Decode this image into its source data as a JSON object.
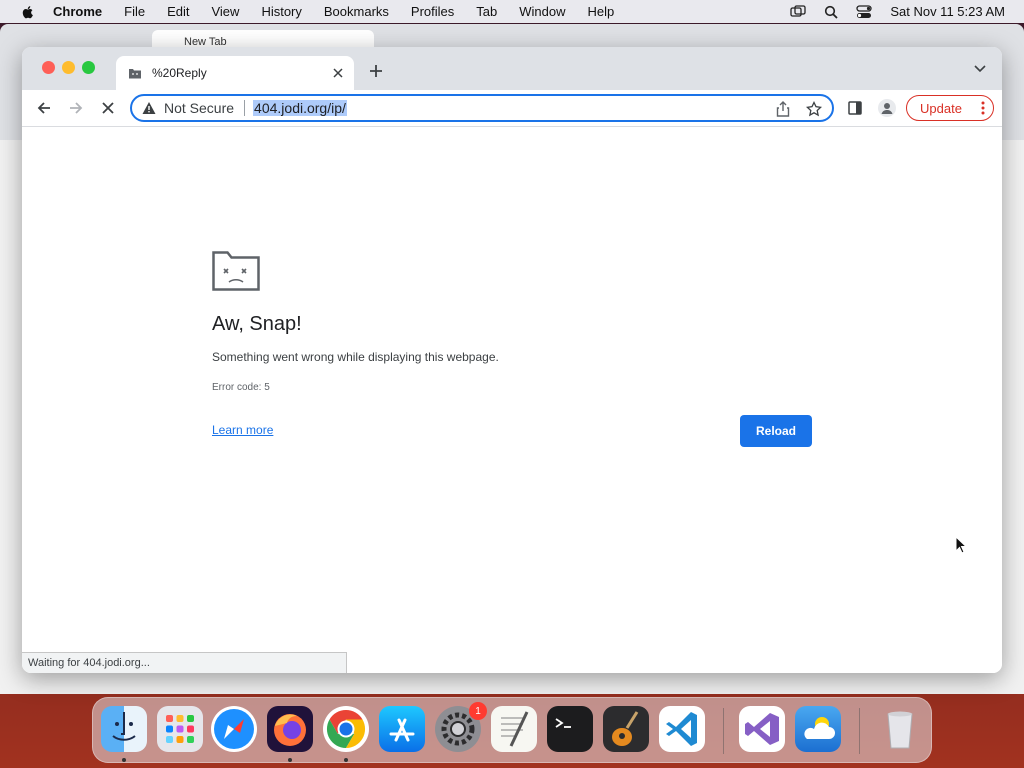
{
  "menubar": {
    "items": [
      "Chrome",
      "File",
      "Edit",
      "View",
      "History",
      "Bookmarks",
      "Profiles",
      "Tab",
      "Window",
      "Help"
    ],
    "clock": "Sat Nov 11  5:23 AM"
  },
  "background_window": {
    "tab_title": "New Tab"
  },
  "tab": {
    "title": "%20Reply"
  },
  "omnibox": {
    "security_label": "Not Secure",
    "url": "404.jodi.org/ip/"
  },
  "update_button": {
    "label": "Update"
  },
  "error_page": {
    "title": "Aw, Snap!",
    "message": "Something went wrong while displaying this webpage.",
    "code": "Error code: 5",
    "learn_more": "Learn more",
    "reload": "Reload"
  },
  "status_bar": {
    "text": "Waiting for 404.jodi.org..."
  },
  "dock": {
    "apps": [
      "finder",
      "launchpad",
      "safari",
      "firefox",
      "chrome",
      "app-store",
      "system-settings",
      "textedit",
      "terminal",
      "garageband",
      "vscode",
      "visual-studio",
      "weather",
      "trash"
    ],
    "settings_badge": "1"
  },
  "colors": {
    "accent": "#1a73e8",
    "update_red": "#d93025"
  }
}
